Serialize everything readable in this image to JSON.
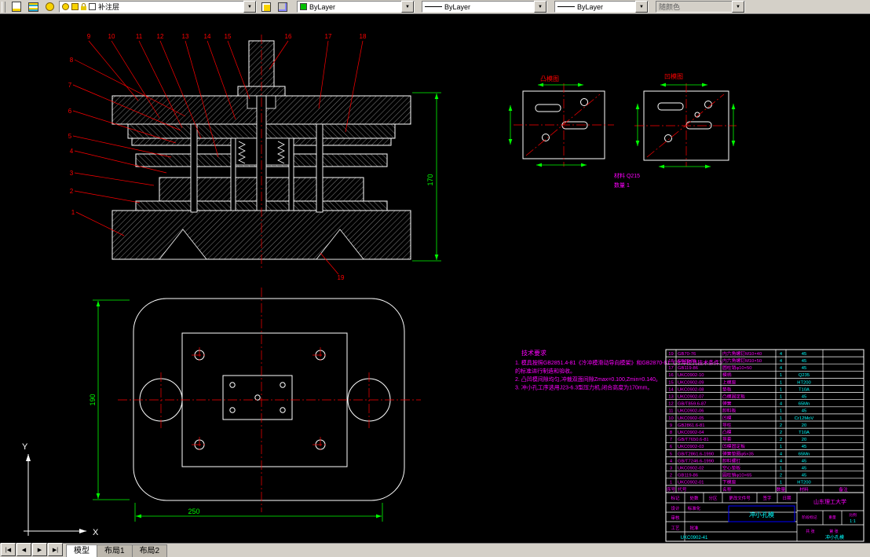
{
  "toolbar": {
    "layer_name": "补注层",
    "color_value": "ByLayer",
    "linetype_value": "ByLayer",
    "lineweight_value": "ByLayer",
    "plotstyle_value": "随颜色",
    "icons": [
      "layer-properties-icon",
      "layer-states-icon",
      "layer-sun-icon",
      "make-object-layer-current-icon",
      "layer-previous-icon"
    ],
    "accent_colors": {
      "chip_green": "#00c000",
      "toolbar_bg": "#d4d0c8"
    }
  },
  "canvas": {
    "callouts_top": [
      "9",
      "10",
      "11",
      "12",
      "13",
      "14",
      "15",
      "16",
      "17",
      "18"
    ],
    "callouts_left": [
      "8",
      "7",
      "6",
      "5",
      "4",
      "3",
      "2",
      "1"
    ],
    "callout_bottom": "19",
    "dims": {
      "assembly_height": "170",
      "plate_width": "250",
      "plate_height": "190"
    },
    "detail_labels": {
      "left": "凸模图",
      "right": "凹模图"
    },
    "material_label": "材料 Q215",
    "quantity_label": "数量 1",
    "notes_title": "技术要求",
    "notes": [
      "1. 模具按照GB2851.4-81《冷冲模滑动导向模架》和GB2870-81《冷冲模具技术条件》",
      "   的标准进行制造和验收。",
      "2. 凸凹模间隙均匀,冲裁双面间隙Zmax=0.100,Zmin=0.140。",
      "3. 冲小孔工序选用J23-6.3型压力机,闭合高度为170mm。"
    ],
    "ucs": {
      "x": "X",
      "y": "Y"
    }
  },
  "parts_table": {
    "header": [
      "序号",
      "代号",
      "名称",
      "数量",
      "材料",
      "备注"
    ],
    "rows": [
      [
        "19",
        "GB70-76",
        "内六角螺钉M10×40",
        "4",
        "45",
        ""
      ],
      [
        "18",
        "GB70-76",
        "内六角螺钉M10×50",
        "4",
        "45",
        ""
      ],
      [
        "17",
        "GB119-86",
        "圆柱销φ10×50",
        "4",
        "45",
        ""
      ],
      [
        "16",
        "UKC0902-10",
        "模柄",
        "1",
        "Q235",
        ""
      ],
      [
        "15",
        "UKC0902-09",
        "上模座",
        "1",
        "HT200",
        ""
      ],
      [
        "14",
        "UKC0902-08",
        "垫板",
        "1",
        "T10A",
        ""
      ],
      [
        "13",
        "UKC0902-07",
        "凸模固定板",
        "1",
        "45",
        ""
      ],
      [
        "12",
        "GB/T859.6-87",
        "弹簧",
        "4",
        "65Mn",
        ""
      ],
      [
        "11",
        "UKC0902-06",
        "卸料板",
        "1",
        "45",
        ""
      ],
      [
        "10",
        "UKC0902-05",
        "凹模",
        "1",
        "Cr12MoV",
        ""
      ],
      [
        "9",
        "GB2861.6-81",
        "导柱",
        "2",
        "20",
        ""
      ],
      [
        "8",
        "UKC0902-04",
        "凸模",
        "2",
        "T10A",
        ""
      ],
      [
        "7",
        "GB/T7650.6-81",
        "导套",
        "2",
        "20",
        ""
      ],
      [
        "6",
        "UKC0902-03",
        "凹模固定板",
        "1",
        "45",
        ""
      ],
      [
        "5",
        "GB/T2861.6-1990",
        "弹簧垫圈φ5×35",
        "4",
        "65Mn",
        ""
      ],
      [
        "4",
        "GB/T7246.6-1990",
        "卸料螺钉",
        "4",
        "45",
        ""
      ],
      [
        "3",
        "UKC0902-02",
        "空心垫板",
        "1",
        "45",
        ""
      ],
      [
        "2",
        "GB119-86",
        "圆柱销φ10×65",
        "2",
        "45",
        ""
      ],
      [
        "1",
        "UKC0902-01",
        "下模座",
        "1",
        "HT200",
        ""
      ]
    ]
  },
  "title_block": {
    "row1": [
      "标记",
      "处数",
      "分区",
      "更改文件号",
      "签字",
      "日期"
    ],
    "sig_labels": [
      "设计",
      "审核",
      "工艺"
    ],
    "approve_label": "批准",
    "std_label": "标准化",
    "stage_label": "阶段标记",
    "weight_label": "重量",
    "scale_label": "比例",
    "scale_value": "1:1",
    "sheets": "共 张",
    "sheet": "第 张",
    "school": "山东理工大学",
    "title": "冲小孔模",
    "drawing_no": "UKC0902-41"
  },
  "tabs": {
    "nav": [
      "|◀",
      "◀",
      "▶",
      "▶|"
    ],
    "items": [
      "模型",
      "布局1",
      "布局2"
    ],
    "active": 0
  }
}
